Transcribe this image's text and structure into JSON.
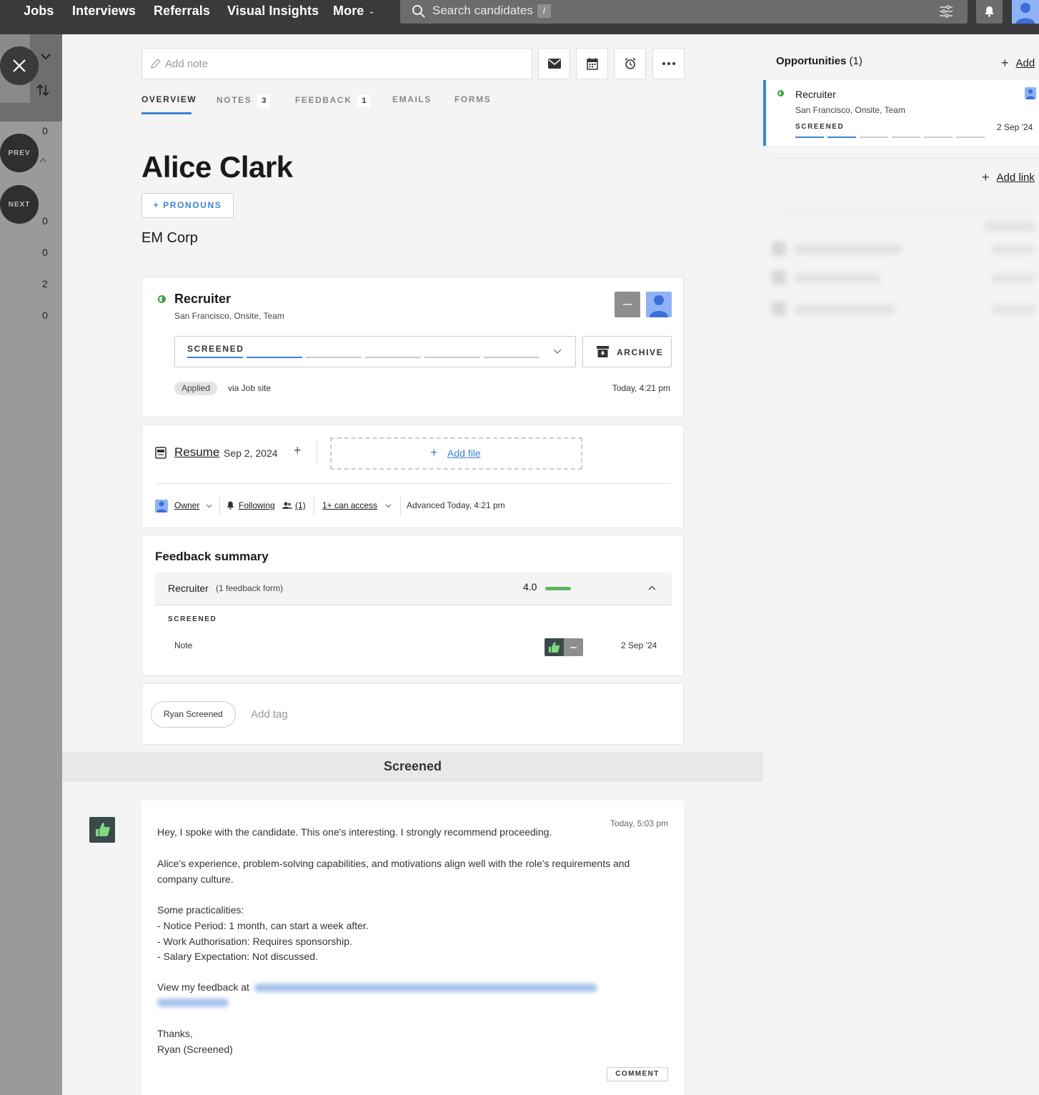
{
  "nav": {
    "items": [
      "Jobs",
      "Interviews",
      "Referrals",
      "Visual Insights",
      "More"
    ],
    "search_placeholder": "Search candidates",
    "search_shortcut": "/"
  },
  "left_rail": {
    "prev_label": "PREV",
    "next_label": "NEXT",
    "counts": [
      "0",
      "0",
      "0",
      "2",
      "0"
    ]
  },
  "toolbar": {
    "add_note_placeholder": "Add note",
    "icons": [
      "mail-icon",
      "calendar-icon",
      "alarm-clock-icon",
      "more-icon"
    ]
  },
  "tabs": [
    {
      "label": "OVERVIEW",
      "count": ""
    },
    {
      "label": "NOTES",
      "count": "3"
    },
    {
      "label": "FEEDBACK",
      "count": "1"
    },
    {
      "label": "EMAILS",
      "count": ""
    },
    {
      "label": "FORMS",
      "count": ""
    }
  ],
  "candidate": {
    "name": "Alice Clark",
    "pronouns_button": "+ PRONOUNS",
    "company": "EM Corp"
  },
  "job_card": {
    "title": "Recruiter",
    "location": "San Francisco, Onsite, Team",
    "stage": "SCREENED",
    "stage_progress": "2 of 6",
    "archive_label": "ARCHIVE",
    "applied_pill": "Applied",
    "source": "via Job site",
    "timestamp": "Today, 4:21 pm"
  },
  "files_card": {
    "resume_label": "Resume",
    "resume_date": "Sep 2, 2024",
    "add_file_label": "Add file",
    "owner_label": "Owner",
    "following_label": "Following",
    "followers_count": "(1)",
    "access_label": "1+ can access",
    "advanced_text": "Advanced Today, 4:21 pm"
  },
  "feedback_summary": {
    "title": "Feedback summary",
    "job": "Recruiter",
    "form_count": "(1 feedback form)",
    "score": "4.0",
    "stage": "SCREENED",
    "row_label": "Note",
    "row_date": "2 Sep '24"
  },
  "tags": {
    "items": [
      "Ryan Screened"
    ],
    "add_placeholder": "Add tag"
  },
  "stage_divider": "Screened",
  "note": {
    "timestamp": "Today, 5:03 pm",
    "line1": "Hey, I spoke with the candidate. This one's interesting. I strongly recommend proceeding.",
    "line2": "Alice's experience, problem-solving capabilities, and motivations align well with the role's requirements and",
    "line3": "company culture.",
    "line4": "Some practicalities:",
    "line5": "- Notice Period: 1 month, can start a week after.",
    "line6": "- Work Authorisation: Requires sponsorship.",
    "line7": "- Salary Expectation: Not discussed.",
    "line8": "View my feedback at",
    "line9": "Thanks,",
    "line10": "Ryan (Screened)",
    "comment_button": "COMMENT"
  },
  "right_panel": {
    "opportunities_title": "Opportunities",
    "opportunities_count": "(1)",
    "add_label": "Add",
    "opp_job": "Recruiter",
    "opp_location": "San Francisco, Onsite, Team",
    "opp_stage": "SCREENED",
    "opp_stage_progress": "2 of 6",
    "opp_date": "2 Sep '24",
    "add_link_label": "Add link"
  },
  "colors": {
    "accent": "#3b82d6",
    "nav_bg": "#3a3a3a",
    "positive": "#5cb85c"
  }
}
